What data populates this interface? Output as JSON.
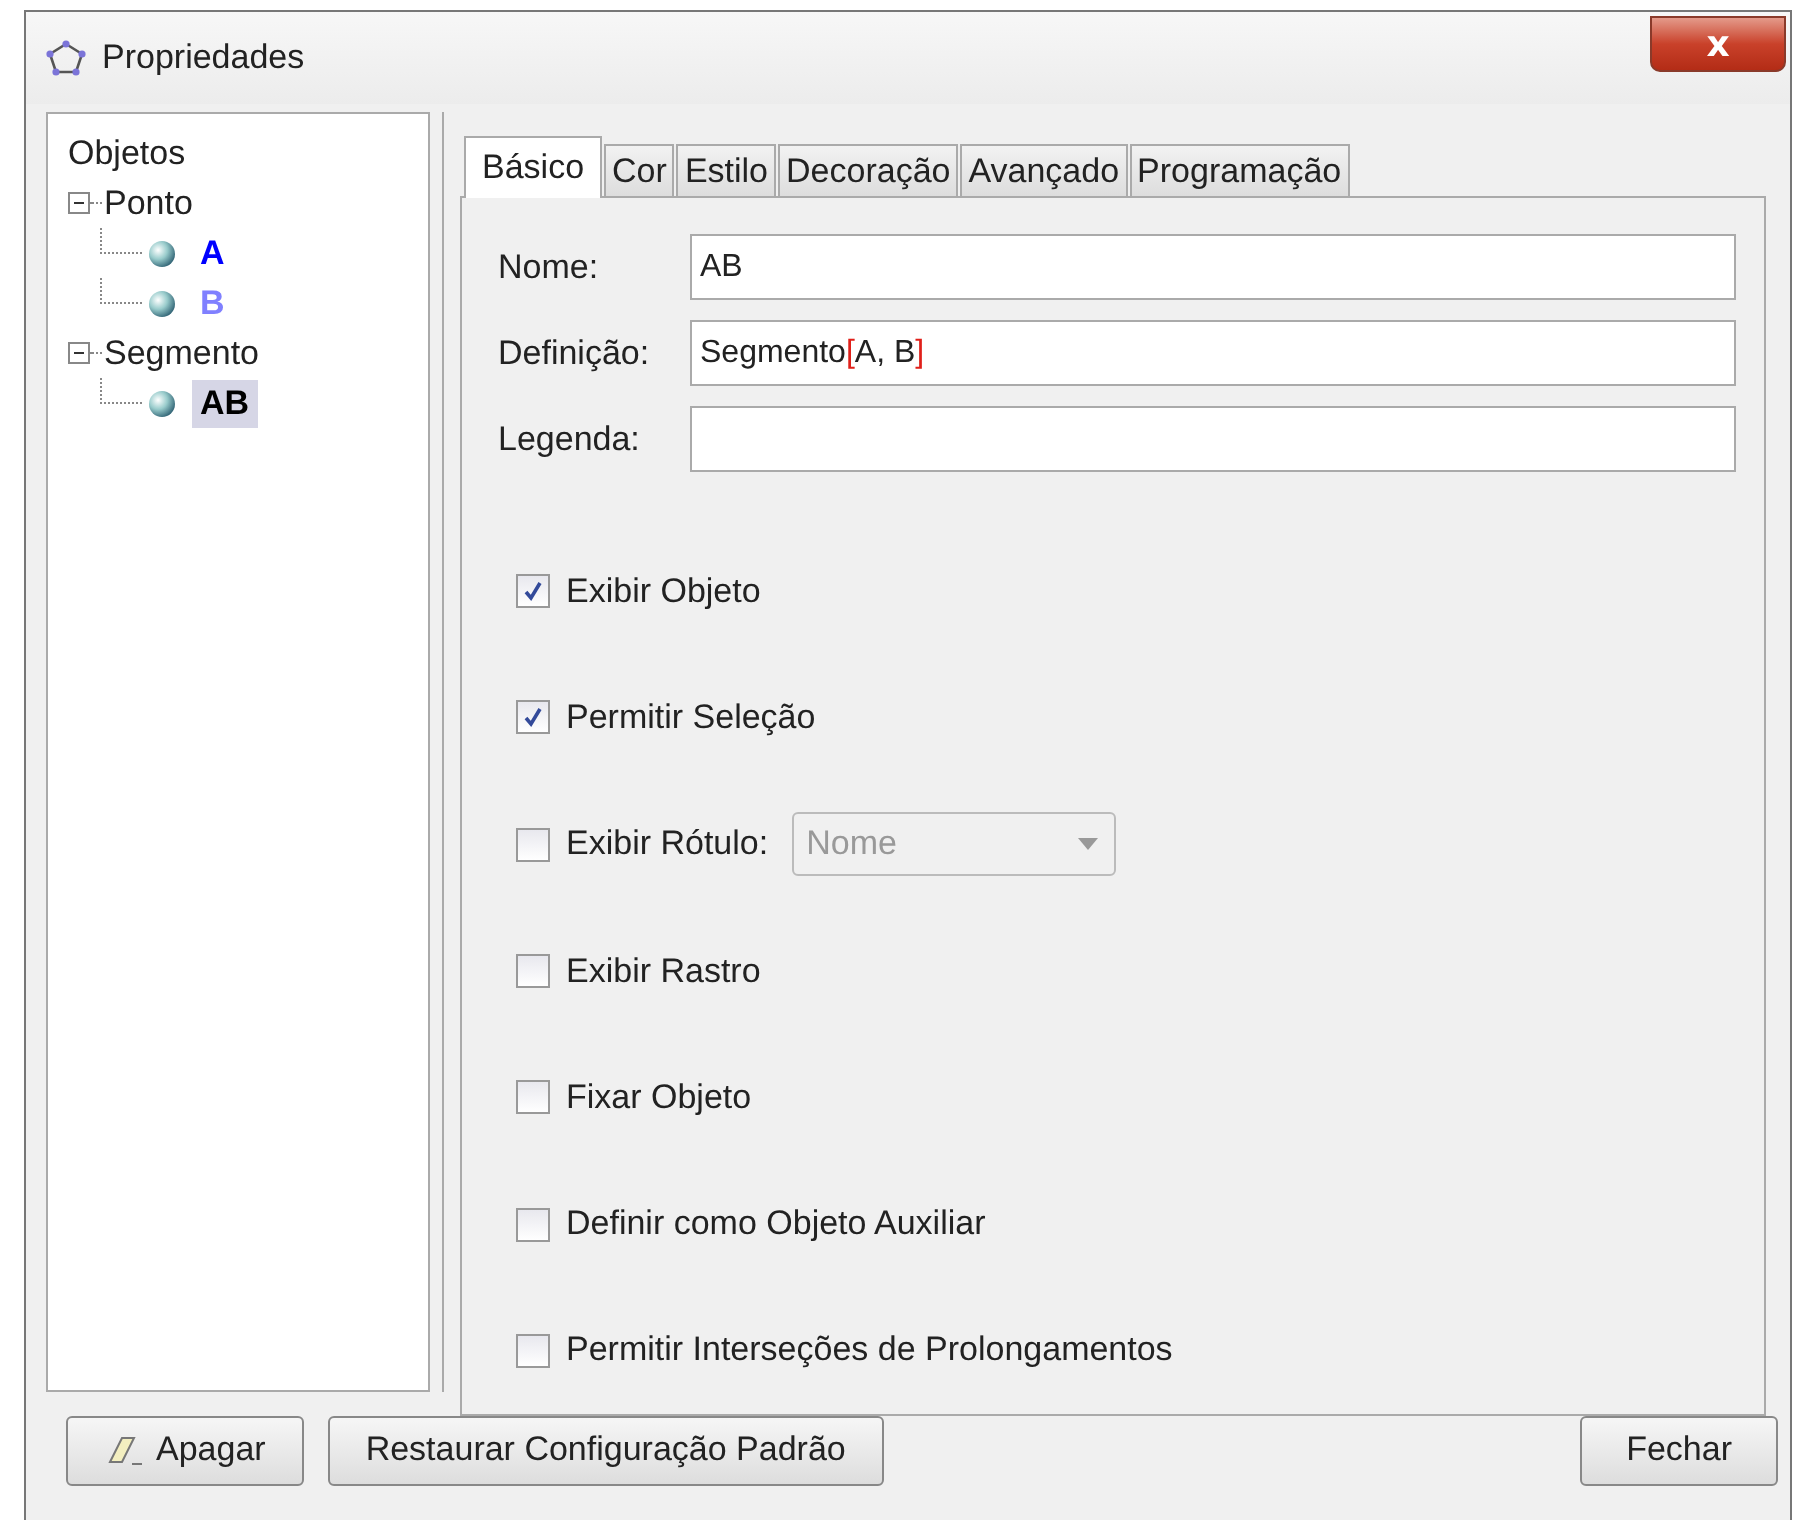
{
  "window": {
    "title": "Propriedades",
    "close": "x"
  },
  "tree": {
    "root": "Objetos",
    "groups": [
      {
        "label": "Ponto",
        "expanded": true,
        "children": [
          {
            "label": "A",
            "color": "#0000ff",
            "selected": false
          },
          {
            "label": "B",
            "color": "#8080ff",
            "selected": false
          }
        ]
      },
      {
        "label": "Segmento",
        "expanded": true,
        "children": [
          {
            "label": "AB",
            "color": "#000000",
            "selected": true
          }
        ]
      }
    ]
  },
  "tabs": [
    {
      "label": "Básico",
      "selected": true
    },
    {
      "label": "Cor",
      "selected": false
    },
    {
      "label": "Estilo",
      "selected": false
    },
    {
      "label": "Decoração",
      "selected": false
    },
    {
      "label": "Avançado",
      "selected": false
    },
    {
      "label": "Programação",
      "selected": false
    }
  ],
  "fields": [
    {
      "label": "Nome:",
      "parts": [
        {
          "text": "AB",
          "kind": "plain"
        }
      ]
    },
    {
      "label": "Definição:",
      "parts": [
        {
          "text": "Segmento",
          "kind": "plain"
        },
        {
          "text": "[",
          "kind": "bracket"
        },
        {
          "text": "A, B",
          "kind": "plain"
        },
        {
          "text": "]",
          "kind": "bracket"
        }
      ]
    },
    {
      "label": "Legenda:"
    }
  ],
  "options": [
    {
      "label": "Exibir Objeto",
      "checked": true
    },
    {
      "label": "Permitir Seleção",
      "checked": true
    },
    {
      "label": "Exibir Rótulo:",
      "checked": false,
      "dropdown": {
        "value": "Nome",
        "disabled": true
      }
    },
    {
      "label": "Exibir Rastro",
      "checked": false
    },
    {
      "label": "Fixar Objeto",
      "checked": false
    },
    {
      "label": "Definir como Objeto Auxiliar",
      "checked": false
    },
    {
      "label": "Permitir Interseções de Prolongamentos",
      "checked": false
    }
  ],
  "buttons": {
    "delete": "Apagar",
    "reset": "Restaurar Configuração Padrão",
    "close": "Fechar"
  }
}
